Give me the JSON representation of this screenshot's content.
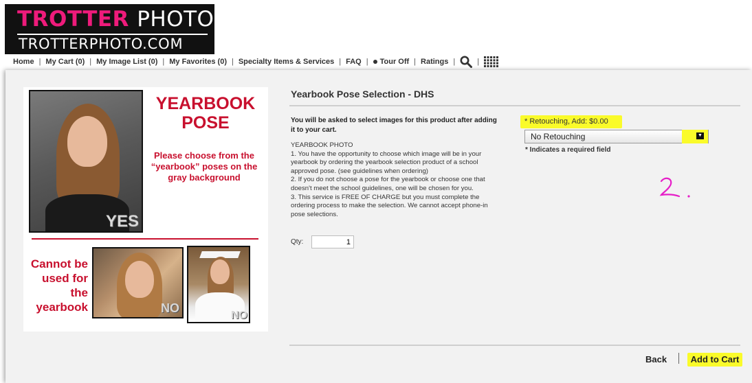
{
  "brand": {
    "logo_word1": "TROTTER",
    "logo_word2": "PHOTO",
    "logo_domain": "TROTTERPHOTO.COM",
    "accent": "#ee1b7b",
    "bg": "#111111"
  },
  "nav": {
    "home": "Home",
    "cart": "My Cart (0)",
    "image_list": "My Image List (0)",
    "favorites": "My Favorites (0)",
    "specialty": "Specialty Items & Services",
    "faq": "FAQ",
    "tour": "Tour Off",
    "ratings": "Ratings",
    "separator": "|",
    "icons": [
      "search-icon",
      "grid-icon"
    ]
  },
  "product_image": {
    "title": "YEARBOOK POSE",
    "subtitle": "Please choose from the “yearbook” poses on the gray background",
    "yes_stamp": "YES",
    "cannot_text": "Cannot be used for the yearbook",
    "no_stamp": "NO",
    "red": "#c8102e"
  },
  "product": {
    "title": "Yearbook Pose Selection - DHS",
    "notice": "You will be asked to select images for this product after adding it to your cart.",
    "description_heading": "YEARBOOK PHOTO",
    "description_1": "1. You have the opportunity to choose which image will be in your yearbook by ordering the yearbook selection product of a school approved pose. (see guidelines when ordering)",
    "description_2": "2. If you do not choose a pose for the yearbook or choose one that doesn't meet the school guidelines, one will be chosen for you.",
    "description_3": "3. This service is FREE OF CHARGE but you must complete the ordering process to make the selection. We cannot accept phone-in pose selections.",
    "qty_label": "Qty:",
    "qty_value": "1"
  },
  "options": {
    "retouch_label": "* Retouching, Add: $0.00",
    "retouch_selected": "No Retouching",
    "required_note": "* Indicates a required field",
    "highlight": "#fafb2a"
  },
  "actions": {
    "back": "Back",
    "add_to_cart": "Add to Cart"
  }
}
